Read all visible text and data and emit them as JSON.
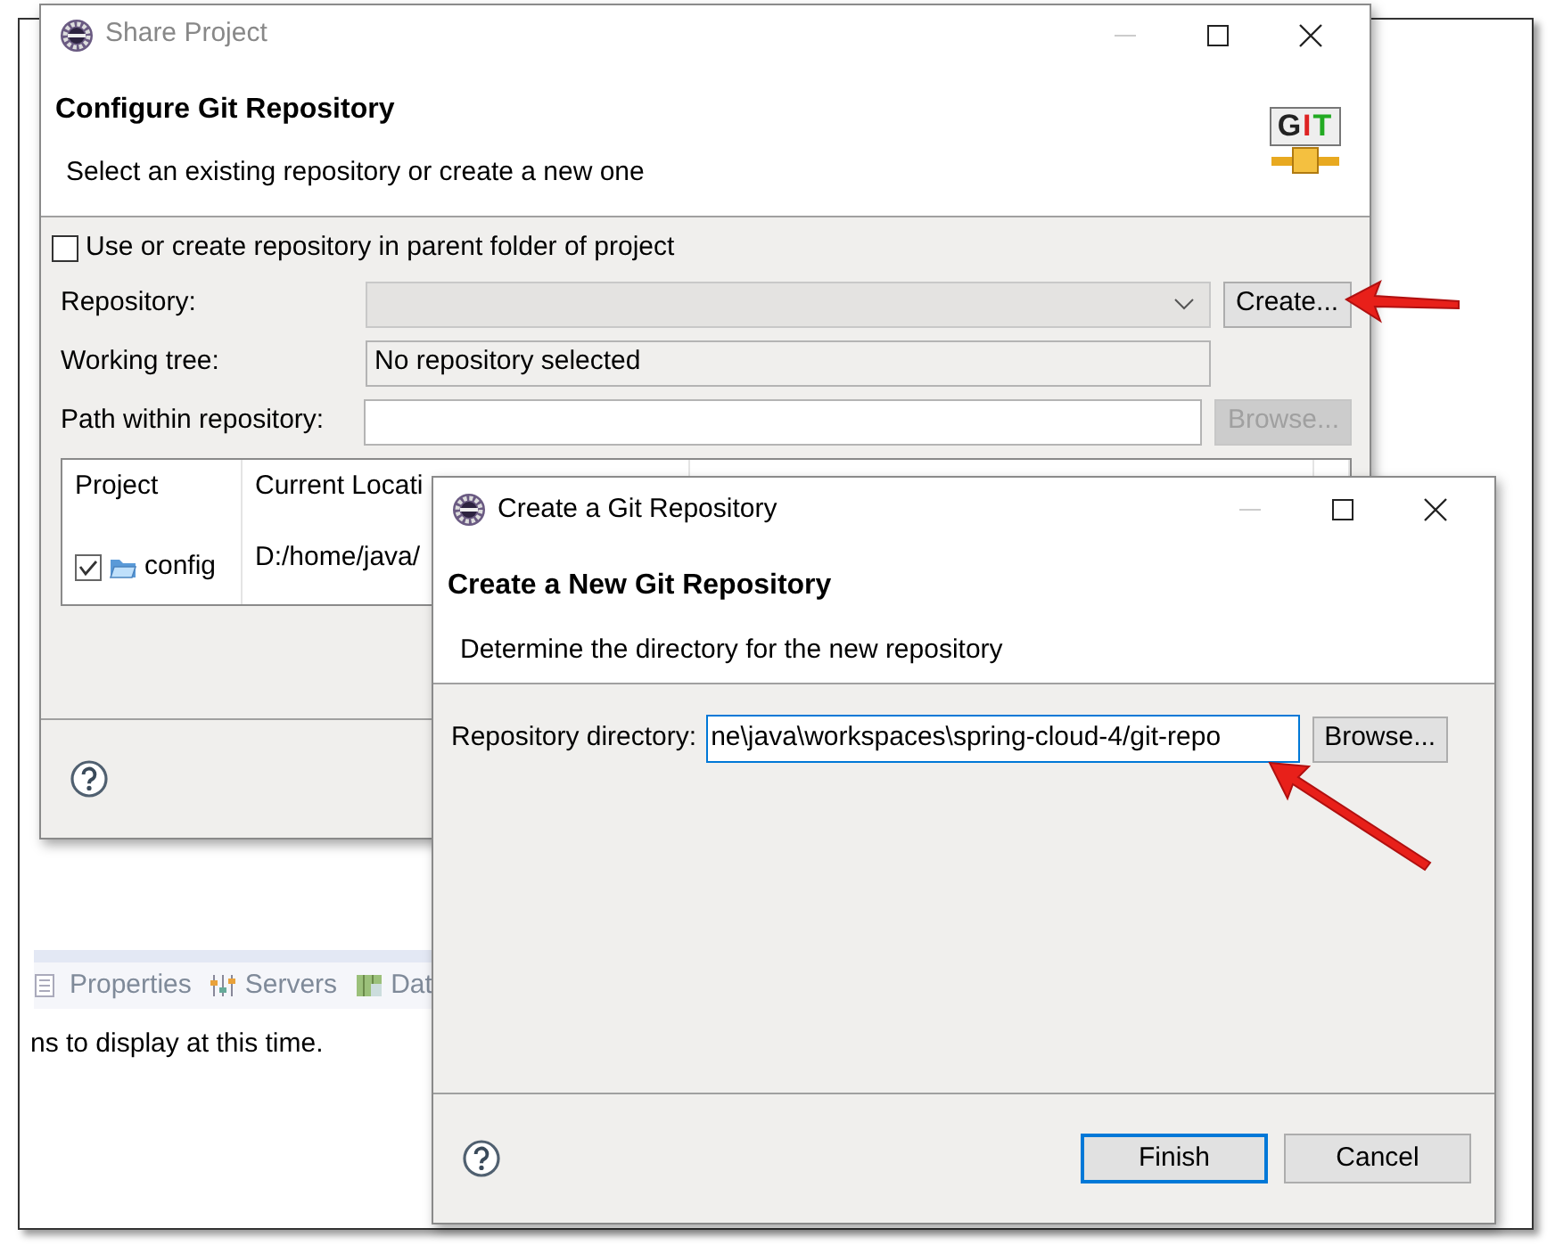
{
  "background": {
    "tabs": [
      {
        "label": "Properties",
        "kind": "properties"
      },
      {
        "label": "Servers",
        "kind": "servers"
      },
      {
        "label": "Dat",
        "kind": "data"
      }
    ],
    "message": "ns to display at this time."
  },
  "share_dialog": {
    "title": "Share Project",
    "header_title": "Configure Git Repository",
    "header_message": "Select an existing repository or create a new one",
    "logo_text": "GIT",
    "parent_folder_option": {
      "label": "Use or create repository in parent folder of project",
      "checked": false
    },
    "repository": {
      "label": "Repository:",
      "button": "Create..."
    },
    "working_tree": {
      "label": "Working tree:",
      "value": "No repository selected"
    },
    "path_within_repository": {
      "label": "Path within repository:",
      "button": "Browse...",
      "button_disabled": true
    },
    "table": {
      "columns": [
        "Project",
        "Current Locati"
      ],
      "rows": [
        {
          "checked": true,
          "project": "config",
          "current_location": "D:/home/java/"
        }
      ]
    }
  },
  "create_dialog": {
    "title": "Create a Git Repository",
    "header_title": "Create a New Git Repository",
    "header_message": "Determine the directory for the new repository",
    "directory": {
      "label": "Repository directory:",
      "value": "ne\\java\\workspaces\\spring-cloud-4/git-repo",
      "button": "Browse..."
    },
    "buttons": [
      {
        "label": "Finish",
        "default": true
      },
      {
        "label": "Cancel",
        "default": false
      }
    ]
  }
}
